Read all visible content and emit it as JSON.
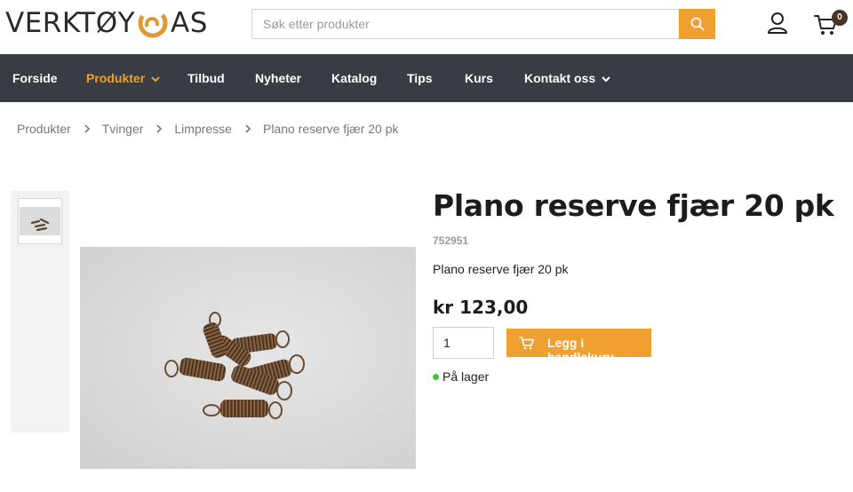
{
  "brand": {
    "logo_left": "VERKTØY",
    "logo_right": "AS"
  },
  "search": {
    "placeholder": "Søk etter produkter",
    "value": ""
  },
  "header": {
    "user_icon": "user-icon",
    "cart_icon": "cart-icon",
    "cart_count": "0"
  },
  "nav": {
    "items": [
      {
        "label": "Forside"
      },
      {
        "label": "Produkter"
      },
      {
        "label": "Tilbud"
      },
      {
        "label": "Nyheter"
      },
      {
        "label": "Katalog"
      },
      {
        "label": "Tips"
      },
      {
        "label": "Kurs"
      },
      {
        "label": "Kontakt oss"
      }
    ],
    "active_item": "Produkter"
  },
  "breadcrumb": {
    "items": [
      "Produkter",
      "Tvinger",
      "Limpresse",
      "Plano reserve fjær 20 pk"
    ]
  },
  "product": {
    "title": "Plano reserve fjær 20 pk",
    "sku": "752951",
    "short_description": "Plano reserve fjær 20 pk",
    "price": "kr 123,00",
    "quantity": "1",
    "add_to_cart_label": "Legg i handlekurv",
    "stock_status": "På lager"
  },
  "colors": {
    "accent": "#f0a030",
    "nav_background": "#373d42",
    "in_stock": "#3cc43c",
    "cart_badge": "#4a3320"
  }
}
